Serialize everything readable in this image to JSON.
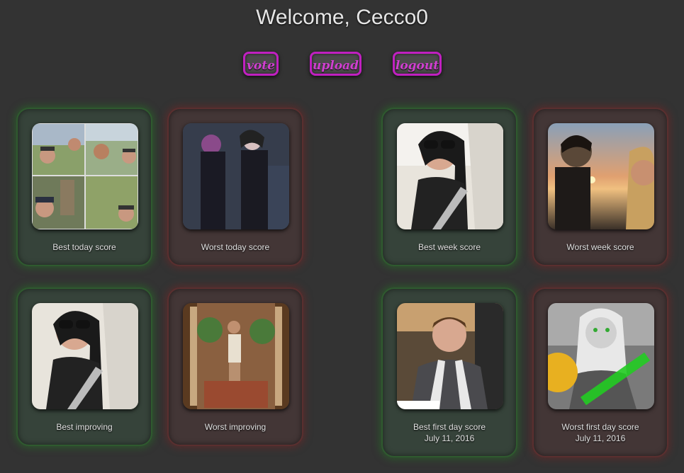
{
  "header": {
    "welcome": "Welcome, Cecco0"
  },
  "nav": {
    "vote": "vote",
    "upload": "upload",
    "logout": "logout"
  },
  "cards": [
    {
      "label": "Best today score"
    },
    {
      "label": "Worst today score"
    },
    {
      "label": "Best week score"
    },
    {
      "label": "Worst week score"
    },
    {
      "label": "Best improving"
    },
    {
      "label": "Worst improving"
    },
    {
      "label": "Best first day score",
      "date": "July 11, 2016"
    },
    {
      "label": "Worst first day score",
      "date": "July 11, 2016"
    }
  ],
  "colors": {
    "accent": "#c020c0",
    "best_glow": "#2f6a2f",
    "worst_glow": "#6a2f2f",
    "background": "#333333"
  }
}
